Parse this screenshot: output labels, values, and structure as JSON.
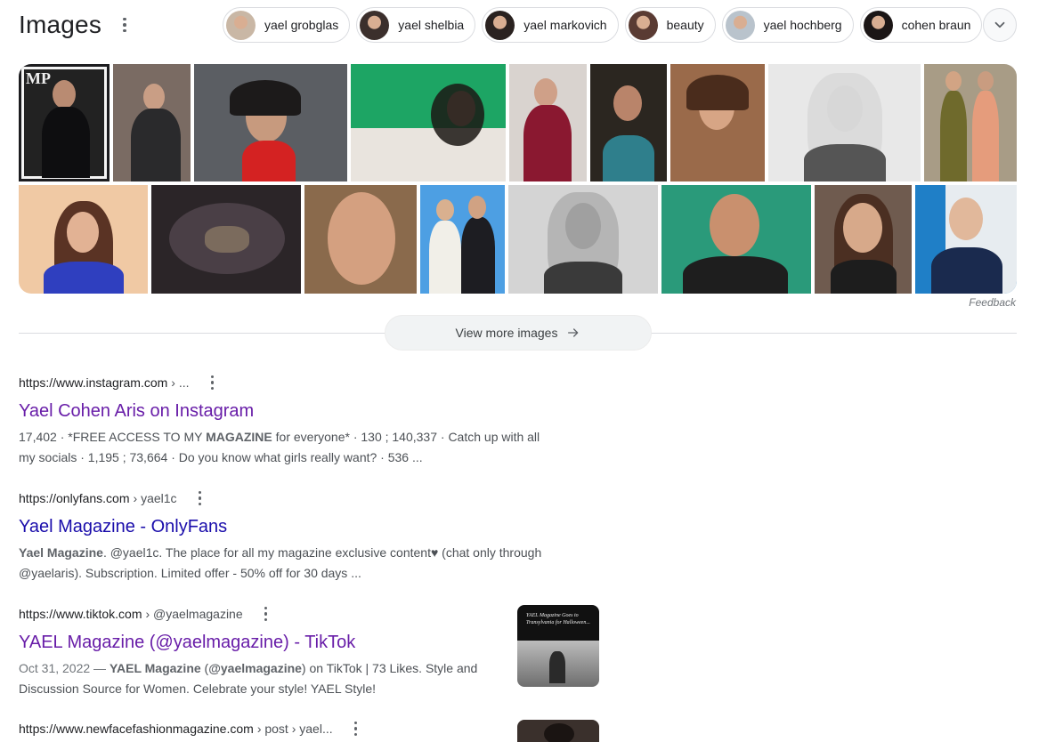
{
  "images": {
    "title": "Images",
    "chips": [
      {
        "label": "yael grobglas",
        "color": "#c9b7a5"
      },
      {
        "label": "yael shelbia",
        "color": "#3b2f2c"
      },
      {
        "label": "yael markovich",
        "color": "#2a2220"
      },
      {
        "label": "beauty",
        "color": "#5a3b33"
      },
      {
        "label": "yael hochberg",
        "color": "#b9c3cc"
      },
      {
        "label": "cohen braun",
        "color": "#1b1616"
      }
    ],
    "feedback": "Feedback",
    "view_more": "View more images",
    "row1_bg": [
      "#1c1c1f",
      "#7a6b63",
      "#5b5e63",
      "#1da564",
      "#d9d3cf",
      "#2b2620",
      "#9a6a4a",
      "#e8e8e8",
      "#a89c86"
    ],
    "row2_bg": [
      "#f0c9a4",
      "#2b2528",
      "#8a6a4c",
      "#4d9fe3",
      "#d4d4d4",
      "#2a9a7a",
      "#6f5b4f",
      "#1f7fc7"
    ]
  },
  "results": [
    {
      "domain": "https://www.instagram.com",
      "path": "› ...",
      "title": "Yael Cohen Aris on Instagram",
      "snippet_html": "17,402 · *FREE ACCESS TO MY <b>MAGAZINE</b> for everyone* · 130 ; 140,337 · Catch up with all my socials · 1,195 ; 73,664 · Do you know what girls really want? · 536 ...",
      "visited": true
    },
    {
      "domain": "https://onlyfans.com",
      "path": "› yael1c",
      "title": "Yael Magazine - OnlyFans",
      "snippet_html": "<b>Yael Magazine</b>. @yael1c. The place for all my magazine exclusive content♥ (chat only through @yaelaris). Subscription. Limited offer - 50% off for 30 days ...",
      "visited": false
    },
    {
      "domain": "https://www.tiktok.com",
      "path": "› @yaelmagazine",
      "title": "YAEL Magazine (@yaelmagazine) - TikTok",
      "date": "Oct 31, 2022 — ",
      "snippet_html": "<b>YAEL Magazine</b> (<b>@yaelmagazine</b>) on TikTok | 73 Likes. Style and Discussion Source for Women. Celebrate your style! YAEL Style!",
      "thumb_caption": "YAEL Magazine Goes to Transylvania for Halloween...",
      "visited": true
    },
    {
      "domain": "https://www.newfacefashionmagazine.com",
      "path": "› post › yael...",
      "visited": false
    }
  ]
}
